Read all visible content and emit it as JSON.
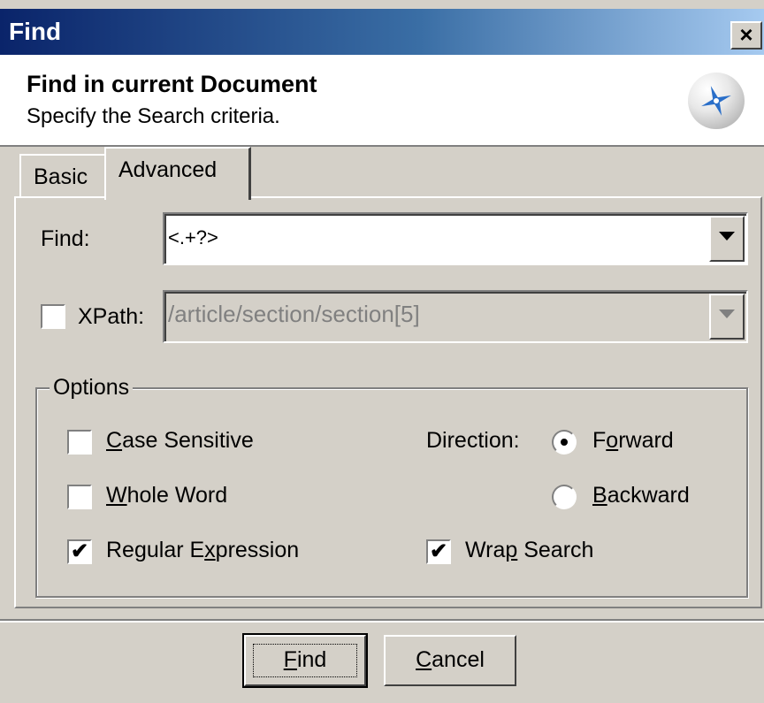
{
  "window": {
    "title": "Find",
    "close_glyph": "×"
  },
  "banner": {
    "title": "Find in current Document",
    "subtitle": "Specify the Search criteria.",
    "logo_icon": "compass-logo-icon"
  },
  "tabs": [
    {
      "label": "Basic",
      "selected": false
    },
    {
      "label": "Advanced",
      "selected": true
    }
  ],
  "find": {
    "label": "Find:",
    "value": "<.+?>"
  },
  "xpath": {
    "label": "XPath:",
    "checked": false,
    "value": "/article/section/section[5]",
    "enabled": false
  },
  "options": {
    "legend": "Options",
    "case_sensitive": {
      "pre": "",
      "accel": "C",
      "post": "ase Sensitive",
      "checked": false
    },
    "whole_word": {
      "pre": "",
      "accel": "W",
      "post": "hole Word",
      "checked": false
    },
    "regular_expression": {
      "pre": "Regular E",
      "accel": "x",
      "post": "pression",
      "checked": true
    },
    "wrap_search": {
      "pre": "Wra",
      "accel": "p",
      "post": " Search",
      "checked": true
    },
    "direction_label": "Direction:",
    "forward": {
      "pre": "F",
      "accel": "o",
      "post": "rward",
      "selected": true
    },
    "backward": {
      "pre": "",
      "accel": "B",
      "post": "ackward",
      "selected": false
    }
  },
  "buttons": {
    "find": {
      "pre": "",
      "accel": "F",
      "post": "ind"
    },
    "cancel": {
      "pre": "",
      "accel": "C",
      "post": "ancel"
    }
  },
  "check_glyph": "✔"
}
